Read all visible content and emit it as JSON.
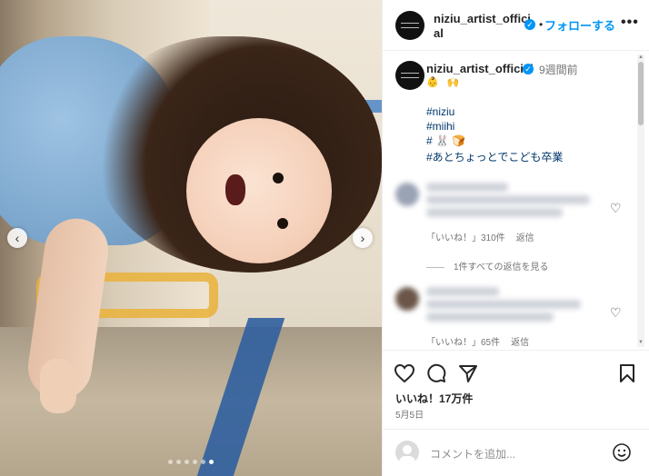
{
  "photo": {
    "prev_label": "‹",
    "next_label": "›",
    "dots_count": 6,
    "active_dot": 5
  },
  "header": {
    "username": "niziu_artist_official",
    "follow_sep": "•",
    "follow_label": "フォローする",
    "more_label": "•••"
  },
  "caption": {
    "username": "niziu_artist_official",
    "time": "9週間前",
    "emoji": "👶 🙌",
    "tags": [
      "#niziu",
      "#miihi",
      "# 🐰 🍞",
      "#あとちょっとでこども卒業"
    ]
  },
  "comments": [
    {
      "likes": "「いいね！」310件",
      "reply": "返信",
      "heart": "♡"
    },
    {
      "likes": "「いいね！」65件",
      "reply": "返信",
      "heart": "♡"
    }
  ],
  "view_all_replies": "1件すべての返信を見る",
  "actions": {
    "likes": "いいね！17万件",
    "date": "5月5日"
  },
  "composer": {
    "placeholder": "コメントを追加..."
  },
  "colors": {
    "accent": "#0095f6",
    "hashtag": "#00376b",
    "muted": "#737373"
  },
  "icons": [
    "heart-icon",
    "comment-icon",
    "share-icon",
    "bookmark-icon",
    "emoji-icon",
    "verified-badge-icon"
  ]
}
